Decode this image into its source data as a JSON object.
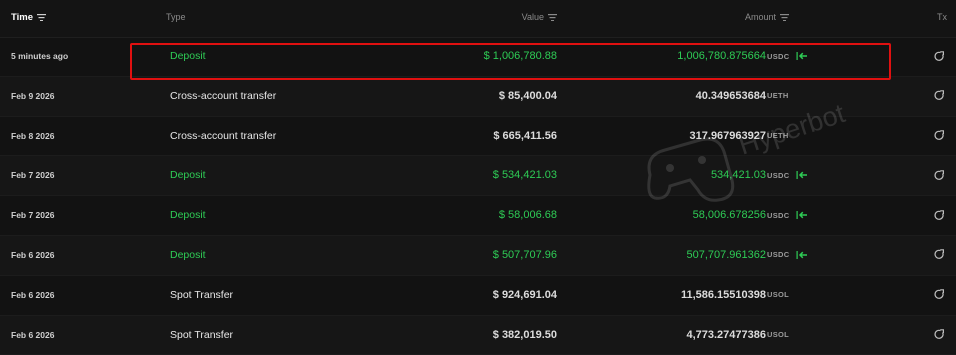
{
  "header": {
    "time": "Time",
    "type": "Type",
    "value": "Value",
    "amount": "Amount",
    "tx": "Tx"
  },
  "rows": [
    {
      "time": "5 minutes ago",
      "type": "Deposit",
      "value": "$ 1,006,780.88",
      "amount": "1,006,780.875664",
      "unit": "USDC",
      "kind": "deposit"
    },
    {
      "time": "Feb 9 2026",
      "type": "Cross-account transfer",
      "value": "$ 85,400.04",
      "amount": "40.349653684",
      "unit": "UETH",
      "kind": "transfer"
    },
    {
      "time": "Feb 8 2026",
      "type": "Cross-account transfer",
      "value": "$ 665,411.56",
      "amount": "317.967963927",
      "unit": "UETH",
      "kind": "transfer"
    },
    {
      "time": "Feb 7 2026",
      "type": "Deposit",
      "value": "$ 534,421.03",
      "amount": "534,421.03",
      "unit": "USDC",
      "kind": "deposit"
    },
    {
      "time": "Feb 7 2026",
      "type": "Deposit",
      "value": "$ 58,006.68",
      "amount": "58,006.678256",
      "unit": "USDC",
      "kind": "deposit"
    },
    {
      "time": "Feb 6 2026",
      "type": "Deposit",
      "value": "$ 507,707.96",
      "amount": "507,707.961362",
      "unit": "USDC",
      "kind": "deposit"
    },
    {
      "time": "Feb 6 2026",
      "type": "Spot Transfer",
      "value": "$ 924,691.04",
      "amount": "11,586.15510398",
      "unit": "USOL",
      "kind": "transfer"
    },
    {
      "time": "Feb 6 2026",
      "type": "Spot Transfer",
      "value": "$ 382,019.50",
      "amount": "4,773.27477386",
      "unit": "USOL",
      "kind": "transfer"
    }
  ],
  "watermark": "Hyperbot",
  "colors": {
    "background": "#121212",
    "deposit_green": "#2ecc55",
    "highlight_red": "#e01010"
  },
  "icons": {
    "sort": "sort-icon",
    "deposit_arrow": "arrow-in-icon",
    "tx_link": "external-link-icon"
  }
}
